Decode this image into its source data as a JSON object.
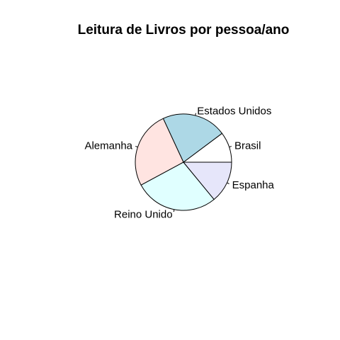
{
  "chart_data": {
    "type": "pie",
    "title": "Leitura de Livros por pessoa/ano",
    "slices": [
      {
        "label": "Brasil",
        "value": 2.4,
        "color": "#ffffff"
      },
      {
        "label": "Estados Unidos",
        "value": 5.1,
        "color": "#add8e6"
      },
      {
        "label": "Alemanha",
        "value": 6.1,
        "color": "#ffe4e1"
      },
      {
        "label": "Reino Unido",
        "value": 6.6,
        "color": "#e0ffff"
      },
      {
        "label": "Espanha",
        "value": 3.3,
        "color": "#e6e6fa"
      }
    ],
    "start": "3 o'clock, counter-clockwise",
    "legend": "none",
    "grid": false
  }
}
